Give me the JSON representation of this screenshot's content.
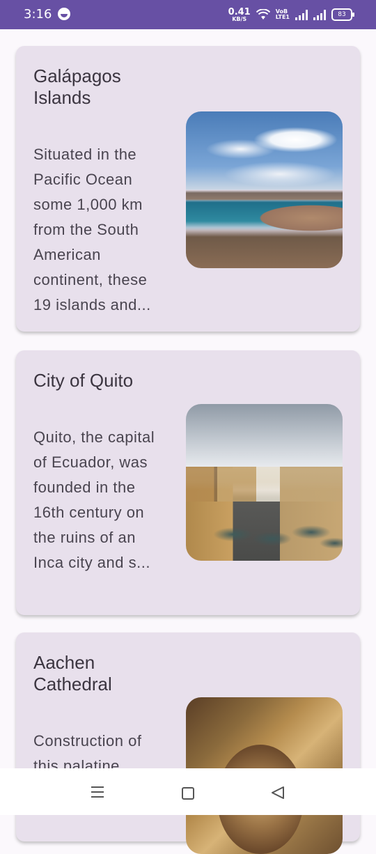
{
  "status_bar": {
    "time": "3:16",
    "net_speed_value": "0.41",
    "net_speed_unit": "KB/S",
    "volte_top": "VoB",
    "volte_bottom": "LTE1",
    "battery": "83"
  },
  "places": [
    {
      "title": "Galápagos Islands",
      "description": "Situated in the Pacific Ocean some 1,000 km from the South American continent, these 19 islands and..."
    },
    {
      "title": "City of Quito",
      "description": "Quito, the capital of Ecuador, was founded in the 16th century on the ruins of an Inca city and s..."
    },
    {
      "title": "Aachen Cathedral",
      "description": "Construction of this palatine"
    }
  ],
  "nav": {
    "menu_icon": "menu-icon",
    "home_icon": "home-icon",
    "back_icon": "back-icon"
  },
  "colors": {
    "status_bar": "#6750a4",
    "card_background": "#e8e0ec",
    "page_background": "#fbf8fc"
  }
}
